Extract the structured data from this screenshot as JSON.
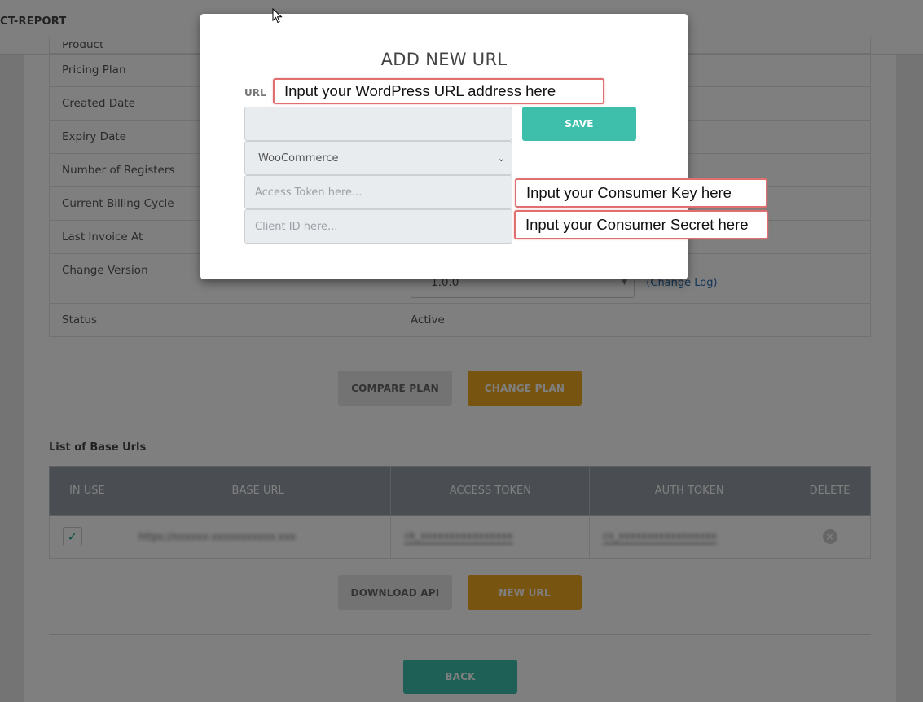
{
  "header": {
    "app_title": "CT-REPORT"
  },
  "info_rows": [
    {
      "label": "Product",
      "value": ""
    },
    {
      "label": "Pricing Plan",
      "value": ""
    },
    {
      "label": "Created Date",
      "value": ""
    },
    {
      "label": "Expiry Date",
      "value": ""
    },
    {
      "label": "Number of Registers",
      "value": ""
    },
    {
      "label": "Current Billing Cycle",
      "value": ""
    },
    {
      "label": "Last Invoice At",
      "value": ""
    },
    {
      "label": "Change Version",
      "version_selected": "1.0.0",
      "changelog_link": "(Change Log)"
    },
    {
      "label": "Status",
      "value": "Active"
    }
  ],
  "plan_buttons": {
    "compare": "COMPARE PLAN",
    "change": "CHANGE PLAN"
  },
  "base_urls": {
    "title": "List of Base Urls",
    "columns": [
      "IN USE",
      "BASE URL",
      "ACCESS TOKEN",
      "AUTH TOKEN",
      "DELETE"
    ],
    "rows": [
      {
        "in_use": true,
        "check_glyph": "✓",
        "base_url": "https://xxxxxx-xxxxxxxxxxx.xxx",
        "access_token": "ck_xxxxxxxxxxxxxxxx",
        "auth_token": "cs_xxxxxxxxxxxxxxxxx",
        "delete_glyph": "×"
      }
    ]
  },
  "url_buttons": {
    "download": "DOWNLOAD API",
    "new_url": "NEW URL"
  },
  "back_label": "BACK",
  "modal": {
    "title": "ADD NEW URL",
    "url_label": "URL",
    "url_value": "",
    "platform_selected": "WooCommerce",
    "access_token_placeholder": "Access Token here...",
    "client_id_placeholder": "Client ID here...",
    "save_label": "SAVE",
    "callouts": {
      "url": "Input your WordPress URL address here",
      "consumer_key": "Input your Consumer Key here",
      "consumer_secret": "Input your Consumer Secret here"
    }
  },
  "colors": {
    "accent_teal": "#3dbfac",
    "accent_orange": "#f0a822",
    "callout_border": "#e07070",
    "table_header": "#949ca5"
  }
}
